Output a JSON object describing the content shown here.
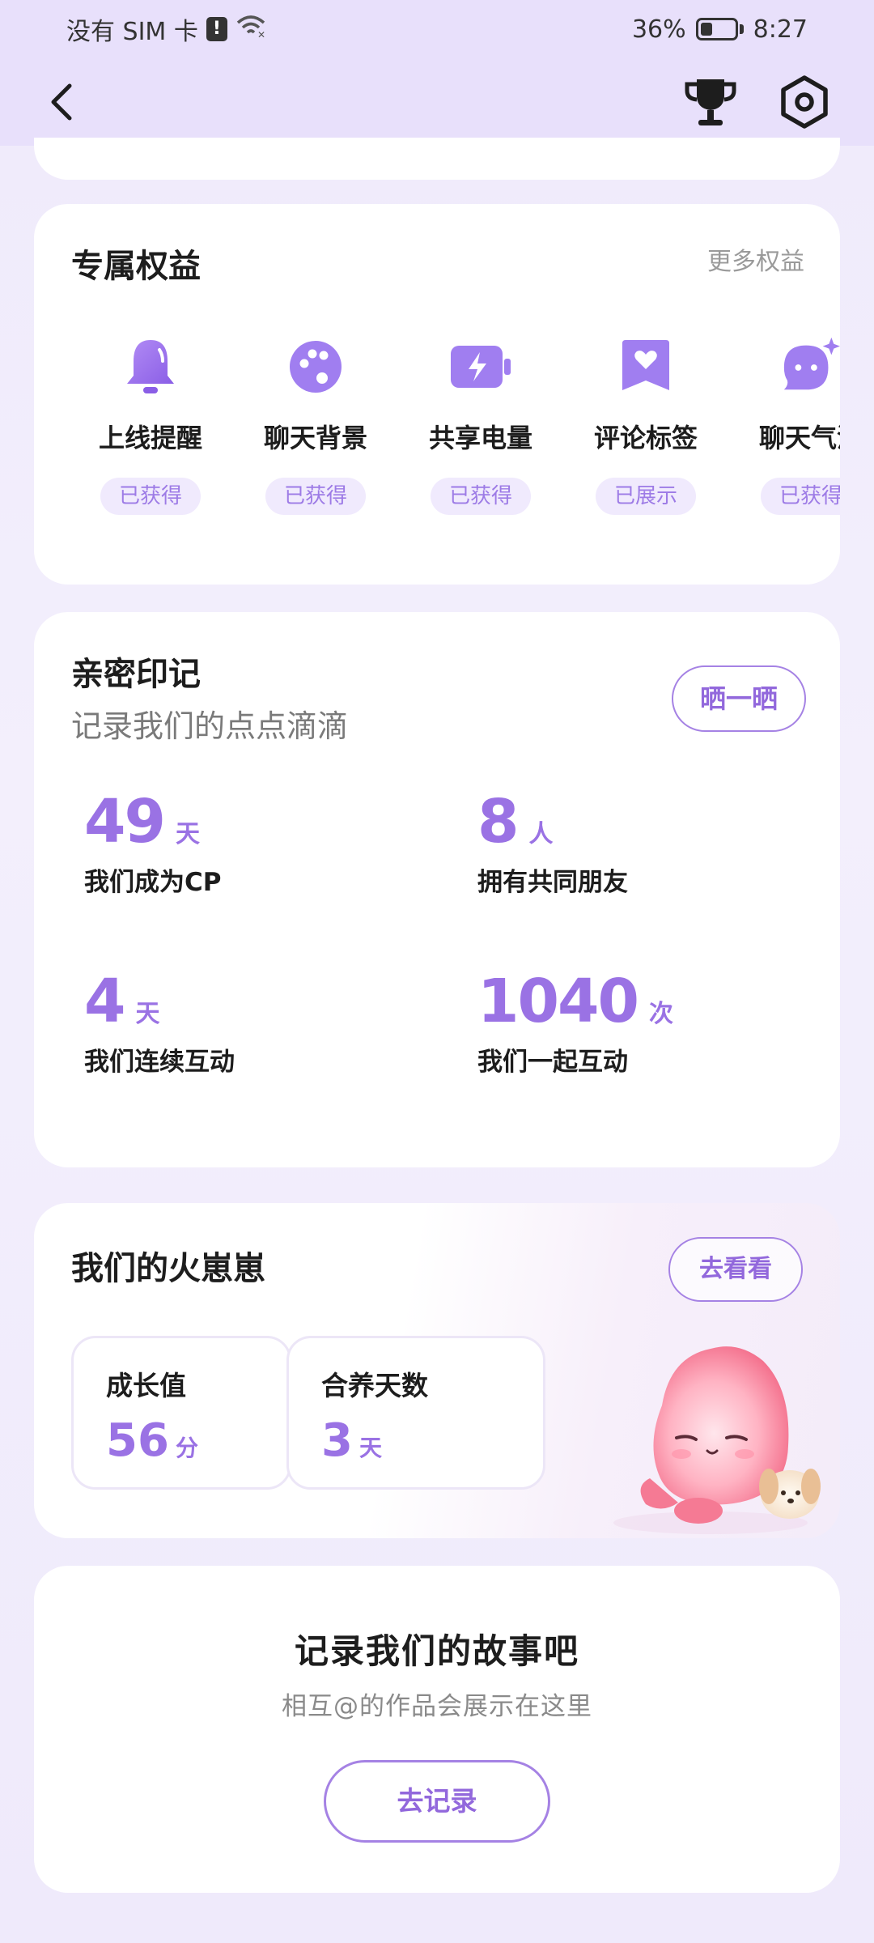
{
  "status_bar": {
    "carrier": "没有 SIM 卡",
    "alert_glyph": "!",
    "battery": "36%",
    "battery_level": 0.36,
    "time": "8:27"
  },
  "nav": {
    "back_icon": "chevron-left-icon",
    "trophy_icon": "trophy-icon",
    "settings_icon": "settings-icon"
  },
  "perks": {
    "title": "专属权益",
    "more": "更多权益",
    "items": [
      {
        "label": "上线提醒",
        "badge": "已获得",
        "icon": "bell-icon"
      },
      {
        "label": "聊天背景",
        "badge": "已获得",
        "icon": "palette-icon"
      },
      {
        "label": "共享电量",
        "badge": "已获得",
        "icon": "battery-share-icon"
      },
      {
        "label": "评论标签",
        "badge": "已展示",
        "icon": "heart-tag-icon"
      },
      {
        "label": "聊天气泡",
        "badge": "已获得",
        "icon": "chat-bubble-icon"
      }
    ]
  },
  "intimacy": {
    "title": "亲密印记",
    "subtitle": "记录我们的点点滴滴",
    "share_label": "晒一晒",
    "stats": [
      {
        "value": "49",
        "unit": "天",
        "desc": "我们成为CP"
      },
      {
        "value": "8",
        "unit": "人",
        "desc": "拥有共同朋友"
      },
      {
        "value": "4",
        "unit": "天",
        "desc": "我们连续互动"
      },
      {
        "value": "1040",
        "unit": "次",
        "desc": "我们一起互动"
      }
    ]
  },
  "mascot": {
    "title": "我们的火崽崽",
    "look_label": "去看看",
    "growth": {
      "label": "成长值",
      "value": "56",
      "unit": "分"
    },
    "days": {
      "label": "合养天数",
      "value": "3",
      "unit": "天"
    }
  },
  "story": {
    "title": "记录我们的故事吧",
    "subtitle": "相互@的作品会展示在这里",
    "button": "去记录"
  },
  "colors": {
    "accent": "#9a72e4",
    "nav_bg": "#e8e0fb",
    "page_bg": "#efeafb",
    "badge_bg": "#f0eafd"
  }
}
